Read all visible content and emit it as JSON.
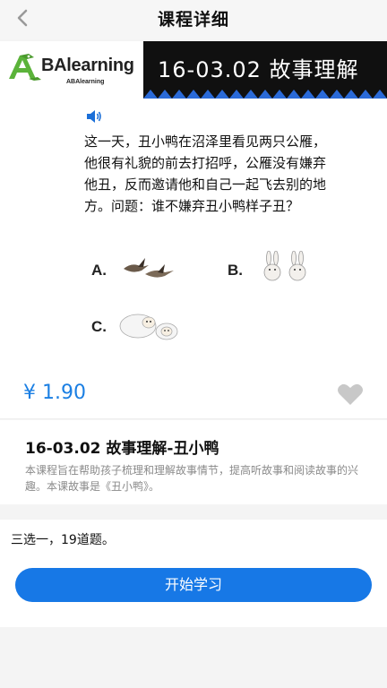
{
  "header": {
    "title": "课程详细",
    "back_icon": "chevron-left-icon"
  },
  "banner": {
    "logo_text": "BAlearning",
    "logo_sub": "ABAlearning",
    "code_title": "16-03.02 故事理解"
  },
  "preview": {
    "sound_icon": "speaker-icon",
    "story": "这一天，丑小鸭在沼泽里看见两只公雁，他很有礼貌的前去打招呼，公雁没有嫌弃他丑，反而邀请他和自己一起飞去别的地方。问题：谁不嫌弃丑小鸭样子丑？",
    "options": [
      {
        "label": "A.",
        "image": "geese-picture"
      },
      {
        "label": "B.",
        "image": "rabbits-picture"
      },
      {
        "label": "C.",
        "image": "sheep-picture"
      }
    ]
  },
  "price": {
    "text": "¥ 1.90",
    "favorite_icon": "heart-icon"
  },
  "course": {
    "name": "16-03.02 故事理解-丑小鸭",
    "description": "本课程旨在帮助孩子梳理和理解故事情节，提高听故事和阅读故事的兴趣。本课故事是《丑小鸭》。"
  },
  "quiz_note": "三选一，19道题。",
  "start_button": "开始学习",
  "colors": {
    "accent": "#1778e6",
    "price": "#1b7fe3",
    "banner_dark": "#101010",
    "zigzag_blue": "#2a6ad8",
    "logo_green": "#5bb33a"
  }
}
